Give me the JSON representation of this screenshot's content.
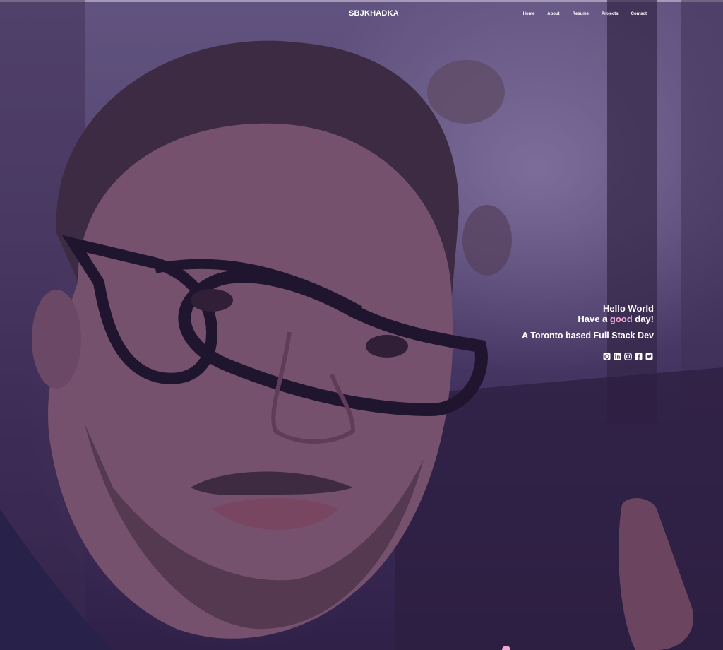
{
  "brand": {
    "name": "SBJKHADKA"
  },
  "nav": {
    "items": [
      {
        "label": "Home"
      },
      {
        "label": "About"
      },
      {
        "label": "Resume"
      },
      {
        "label": "Projects"
      },
      {
        "label": "Contact"
      }
    ]
  },
  "intro": {
    "greeting": "Hello World",
    "wish_prefix": "Have a ",
    "wish_highlight": "good",
    "wish_suffix": " day!",
    "tagline": "A Toronto based Full Stack Dev"
  },
  "social": {
    "icons": [
      "github-icon",
      "linkedin-icon",
      "instagram-icon",
      "facebook-icon",
      "twitter-icon"
    ]
  },
  "colors": {
    "accent": "#f6a6d8",
    "overlay": "#46296e",
    "text": "#ffffff"
  }
}
